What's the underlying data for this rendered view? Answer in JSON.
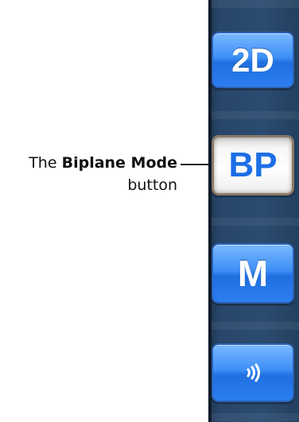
{
  "callout": {
    "prefix": "The ",
    "bold_text": "Biplane Mode",
    "line2": "button"
  },
  "toolbar": {
    "buttons": [
      {
        "label": "2D",
        "active": false
      },
      {
        "label": "BP",
        "active": true
      },
      {
        "label": "M",
        "active": false
      },
      {
        "label": "",
        "icon": "doppler-waves-icon",
        "active": false
      }
    ]
  },
  "colors": {
    "toolbar_bg": "#2b4b70",
    "button_blue": "#3e8ff6",
    "active_text": "#1d6fe6",
    "active_border": "#8a7a6a"
  }
}
